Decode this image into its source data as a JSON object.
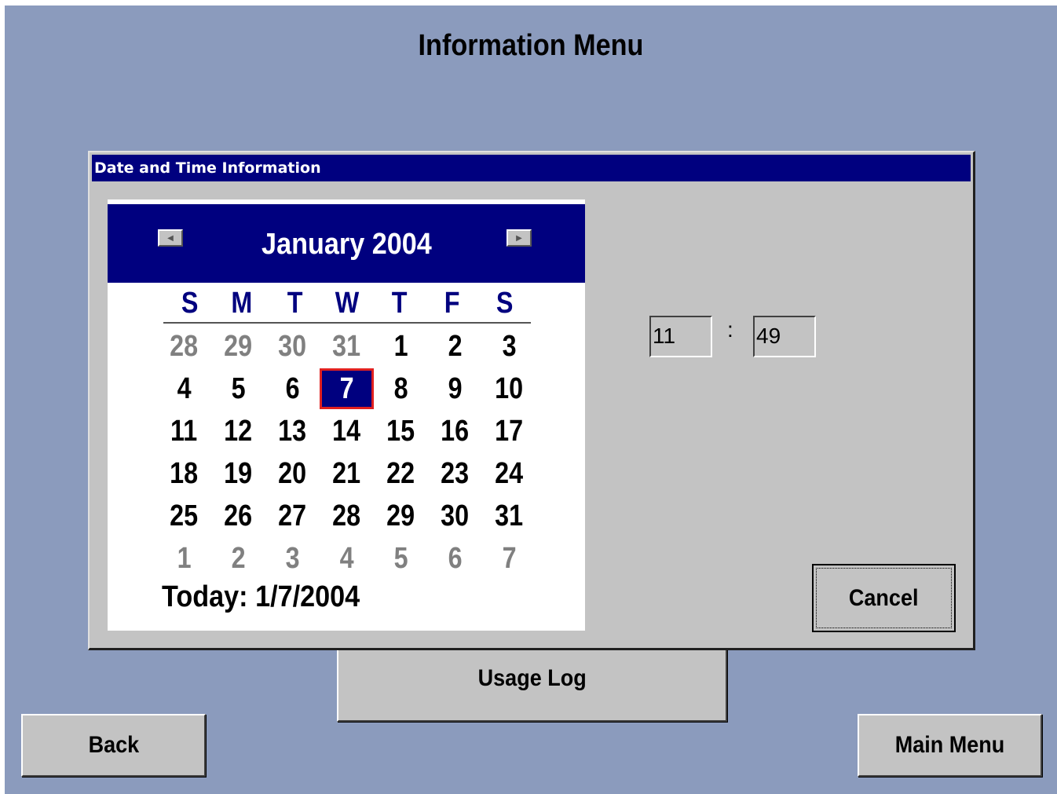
{
  "page": {
    "title": "Information Menu"
  },
  "dialog": {
    "title": "Date and Time Information",
    "calendar": {
      "month_label": "January 2004",
      "prev_icon": "left-arrow-icon",
      "next_icon": "right-arrow-icon",
      "weekdays": [
        "S",
        "M",
        "T",
        "W",
        "T",
        "F",
        "S"
      ],
      "weeks": [
        [
          {
            "d": "28",
            "other": true
          },
          {
            "d": "29",
            "other": true
          },
          {
            "d": "30",
            "other": true
          },
          {
            "d": "31",
            "other": true
          },
          {
            "d": "1"
          },
          {
            "d": "2"
          },
          {
            "d": "3"
          }
        ],
        [
          {
            "d": "4"
          },
          {
            "d": "5"
          },
          {
            "d": "6"
          },
          {
            "d": "7",
            "selected": true
          },
          {
            "d": "8"
          },
          {
            "d": "9"
          },
          {
            "d": "10"
          }
        ],
        [
          {
            "d": "11"
          },
          {
            "d": "12"
          },
          {
            "d": "13"
          },
          {
            "d": "14"
          },
          {
            "d": "15"
          },
          {
            "d": "16"
          },
          {
            "d": "17"
          }
        ],
        [
          {
            "d": "18"
          },
          {
            "d": "19"
          },
          {
            "d": "20"
          },
          {
            "d": "21"
          },
          {
            "d": "22"
          },
          {
            "d": "23"
          },
          {
            "d": "24"
          }
        ],
        [
          {
            "d": "25"
          },
          {
            "d": "26"
          },
          {
            "d": "27"
          },
          {
            "d": "28"
          },
          {
            "d": "29"
          },
          {
            "d": "30"
          },
          {
            "d": "31"
          }
        ],
        [
          {
            "d": "1",
            "other": true
          },
          {
            "d": "2",
            "other": true
          },
          {
            "d": "3",
            "other": true
          },
          {
            "d": "4",
            "other": true
          },
          {
            "d": "5",
            "other": true
          },
          {
            "d": "6",
            "other": true
          },
          {
            "d": "7",
            "other": true
          }
        ]
      ],
      "today_label": "Today: 1/7/2004"
    },
    "time": {
      "hour": "11",
      "separator": ":",
      "minute": "49"
    },
    "cancel_label": "Cancel"
  },
  "buttons": {
    "usage_log": "Usage Log",
    "back": "Back",
    "main_menu": "Main Menu"
  },
  "colors": {
    "background": "#8b9bbd",
    "panel": "#c3c3c3",
    "title_bar": "#00007f",
    "selection_border": "#e02020",
    "other_month_text": "#808080"
  }
}
